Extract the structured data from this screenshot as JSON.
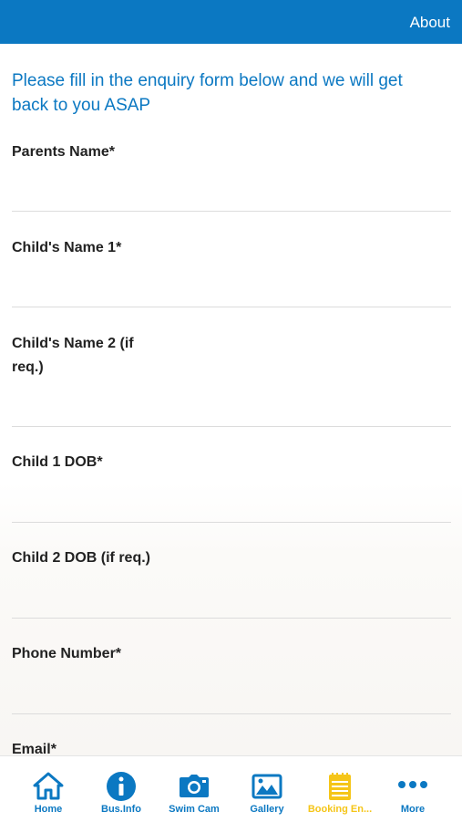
{
  "header": {
    "about_label": "About"
  },
  "form": {
    "intro": "Please fill in the enquiry form below and we will get back to you ASAP",
    "fields": [
      {
        "label": "Parents Name*",
        "value": ""
      },
      {
        "label": "Child's Name 1*",
        "value": ""
      },
      {
        "label": "Child's Name 2 (if req.)",
        "value": ""
      },
      {
        "label": "Child 1 DOB*",
        "value": ""
      },
      {
        "label": "Child 2 DOB (if req.)",
        "value": ""
      },
      {
        "label": "Phone Number*",
        "value": ""
      },
      {
        "label": "Email*",
        "value": ""
      }
    ]
  },
  "tabs": [
    {
      "label": "Home",
      "icon": "home-icon"
    },
    {
      "label": "Bus.Info",
      "icon": "info-icon"
    },
    {
      "label": "Swim Cam",
      "icon": "camera-icon"
    },
    {
      "label": "Gallery",
      "icon": "gallery-icon"
    },
    {
      "label": "Booking En...",
      "icon": "notepad-icon",
      "active": true
    },
    {
      "label": "More",
      "icon": "more-icon"
    }
  ],
  "colors": {
    "primary": "#0b78c2",
    "active_tab": "#f5c518",
    "divider": "#dcdcdc"
  }
}
